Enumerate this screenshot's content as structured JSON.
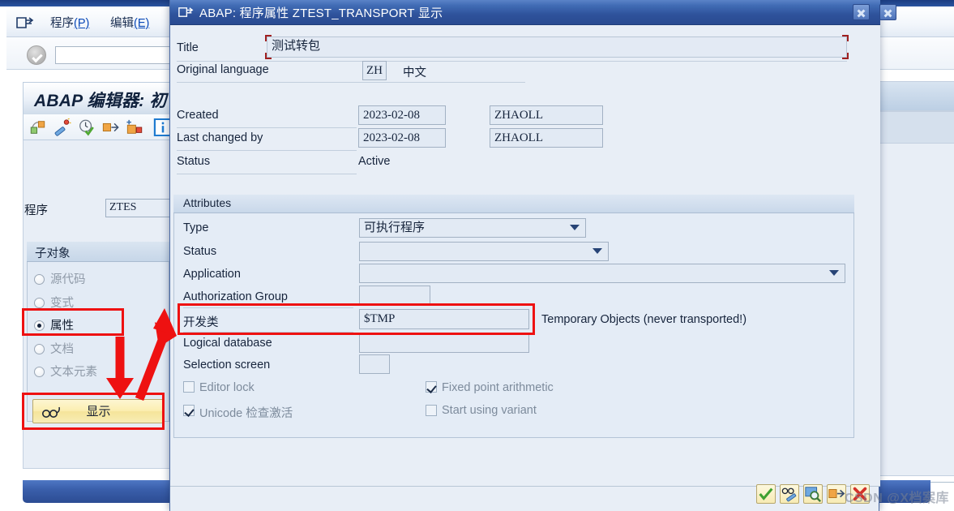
{
  "background": {
    "menu": {
      "icon": "window-list-icon",
      "items": [
        {
          "label": "程序",
          "accel": "(P)"
        },
        {
          "label": "编辑",
          "accel": "(E)"
        }
      ]
    },
    "command_field": {
      "value": "",
      "placeholder": ""
    },
    "ok_icon": "ok-check-icon",
    "editor": {
      "title": "ABAP 编辑器: 初",
      "toolbar_icons": [
        "object-navigator-icon",
        "pretty-printer-icon",
        "check-syntax-icon",
        "activate-icon",
        "insert-element-icon",
        "information-icon"
      ],
      "program_label": "程序",
      "program_value": "ZTES"
    },
    "subobject_group": {
      "title": "子对象",
      "options": [
        {
          "label": "源代码",
          "selected": false
        },
        {
          "label": "变式",
          "selected": false
        },
        {
          "label": "属性",
          "selected": true
        },
        {
          "label": "文档",
          "selected": false
        },
        {
          "label": "文本元素",
          "selected": false
        }
      ]
    },
    "display_button": {
      "label": "显示",
      "icon": "glasses-display-icon"
    }
  },
  "dialog": {
    "title": "ABAP: 程序属性 ZTEST_TRANSPORT 显示",
    "title_icon": "window-list-icon",
    "close_buttons": [
      "close-icon",
      "close-icon"
    ],
    "header_fields": [
      {
        "label": "Title",
        "value": "测试转包"
      },
      {
        "label": "Original language",
        "value": "ZH",
        "suffix": "中文"
      },
      {
        "label": "Created",
        "value": "2023-02-08",
        "value2": "ZHAOLL"
      },
      {
        "label": "Last changed by",
        "value": "2023-02-08",
        "value2": "ZHAOLL"
      },
      {
        "label": "Status",
        "value": "Active"
      }
    ],
    "attributes": {
      "group_title": "Attributes",
      "fields": [
        {
          "label": "Type",
          "value": "可执行程序",
          "control": "dropdown"
        },
        {
          "label": "Status",
          "value": "",
          "control": "dropdown"
        },
        {
          "label": "Application",
          "value": "",
          "control": "dropdown"
        },
        {
          "label": "Authorization Group",
          "value": "",
          "control": "input"
        },
        {
          "label": "开发类",
          "value": "$TMP",
          "control": "input",
          "suffix": "Temporary Objects (never transported!)",
          "highlighted": true
        },
        {
          "label": "Logical database",
          "value": "",
          "control": "input"
        },
        {
          "label": "Selection screen",
          "value": "",
          "control": "input"
        }
      ],
      "checkboxes": [
        {
          "label": "Editor lock",
          "checked": false
        },
        {
          "label": "Fixed point arithmetic",
          "checked": true
        },
        {
          "label": "Unicode 检查激活",
          "checked": true
        },
        {
          "label": "Start using variant",
          "checked": false
        }
      ]
    },
    "footer_buttons": [
      "confirm-check-icon",
      "display-change-icon",
      "where-used-icon",
      "transport-icon",
      "cancel-icon"
    ]
  },
  "watermark": {
    "text": "CSDN @X档案库"
  },
  "annotations": {
    "boxes": [
      {
        "name": "attribute-radio-highlight"
      },
      {
        "name": "display-button-highlight"
      },
      {
        "name": "devclass-field-highlight"
      }
    ],
    "arrows": [
      {
        "name": "arrow-down-to-display-button"
      },
      {
        "name": "arrow-up-to-devclass-field"
      }
    ],
    "color": "#ee1111"
  }
}
